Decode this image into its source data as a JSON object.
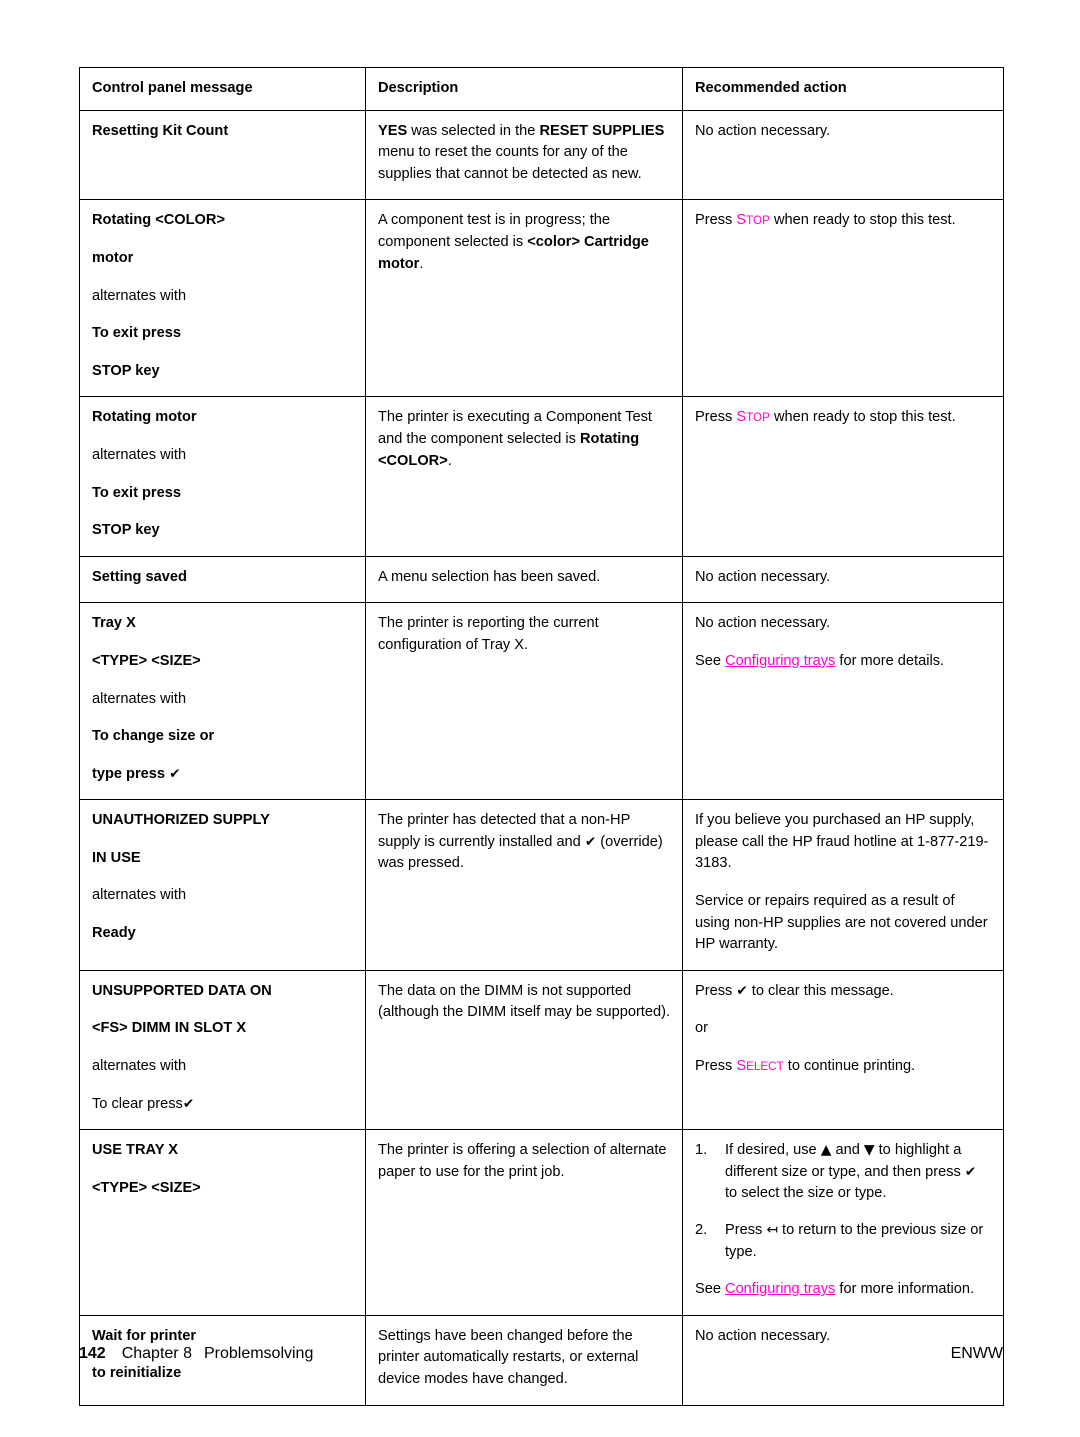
{
  "document": {
    "page_number": "142",
    "chapter": "Chapter 8",
    "section": "Problemsolving",
    "locale_code": "ENWW"
  },
  "colors": {
    "key_magenta": "#ff00cc",
    "link_magenta": "#ff00cc",
    "text": "#000000",
    "border": "#000000"
  },
  "table": {
    "headers": {
      "message": "Control panel message",
      "description": "Description",
      "action": "Recommended action"
    },
    "rows": [
      {
        "message_lines": [
          {
            "text": "Resetting Kit Count",
            "bold": true
          }
        ],
        "description": {
          "parts": [
            {
              "text": "YES",
              "bold": true
            },
            {
              "text": " was selected in the ",
              "bold": false
            },
            {
              "text": "RESET SUPPLIES",
              "bold": true
            },
            {
              "text": " menu to reset the counts for any of the supplies that cannot be detected as new.",
              "bold": false
            }
          ]
        },
        "action": {
          "paragraphs": [
            {
              "parts": [
                {
                  "text": "No action necessary.",
                  "bold": false
                }
              ]
            }
          ]
        }
      },
      {
        "message_lines": [
          {
            "text": "Rotating <COLOR>",
            "bold": true
          },
          {
            "text": "motor",
            "bold": true
          },
          {
            "text": "alternates with",
            "bold": false
          },
          {
            "text": "To exit press",
            "bold": true
          },
          {
            "text": "STOP key",
            "bold": true
          }
        ],
        "description": {
          "parts": [
            {
              "text": "A component test is in progress; the component selected is ",
              "bold": false
            },
            {
              "text": "<color> Cartridge motor",
              "bold": true
            },
            {
              "text": ".",
              "bold": false
            }
          ]
        },
        "action": {
          "paragraphs": [
            {
              "parts": [
                {
                  "text": "Press ",
                  "bold": false
                },
                {
                  "key": "Stop"
                },
                {
                  "text": " when ready to stop this test.",
                  "bold": false
                }
              ]
            }
          ]
        }
      },
      {
        "message_lines": [
          {
            "text": "Rotating motor",
            "bold": true
          },
          {
            "text": "alternates with",
            "bold": false
          },
          {
            "text": "To exit press",
            "bold": true
          },
          {
            "text": "STOP key",
            "bold": true
          }
        ],
        "description": {
          "parts": [
            {
              "text": "The printer is executing a Component Test and the component selected is ",
              "bold": false
            },
            {
              "text": "Rotating <COLOR>",
              "bold": true
            },
            {
              "text": ".",
              "bold": false
            }
          ]
        },
        "action": {
          "paragraphs": [
            {
              "parts": [
                {
                  "text": "Press ",
                  "bold": false
                },
                {
                  "key": "Stop"
                },
                {
                  "text": " when ready to stop this test.",
                  "bold": false
                }
              ]
            }
          ]
        }
      },
      {
        "message_lines": [
          {
            "text": "Setting saved",
            "bold": true
          }
        ],
        "description": {
          "parts": [
            {
              "text": "A menu selection has been saved.",
              "bold": false
            }
          ]
        },
        "action": {
          "paragraphs": [
            {
              "parts": [
                {
                  "text": "No action necessary.",
                  "bold": false
                }
              ]
            }
          ]
        }
      },
      {
        "message_lines": [
          {
            "text": "Tray X",
            "bold": true
          },
          {
            "text": "<TYPE> <SIZE>",
            "bold": true
          },
          {
            "text": "alternates with",
            "bold": false
          },
          {
            "text": "To change size or",
            "bold": true
          },
          {
            "text": "type press ✔",
            "bold": true
          }
        ],
        "description": {
          "parts": [
            {
              "text": "The printer is reporting the current configuration of Tray X.",
              "bold": false
            }
          ]
        },
        "action": {
          "paragraphs": [
            {
              "parts": [
                {
                  "text": "No action necessary.",
                  "bold": false
                }
              ]
            },
            {
              "parts": [
                {
                  "text": "See ",
                  "bold": false
                },
                {
                  "link": "Configuring trays"
                },
                {
                  "text": " for more details.",
                  "bold": false
                }
              ]
            }
          ]
        }
      },
      {
        "message_lines": [
          {
            "text": "UNAUTHORIZED SUPPLY",
            "bold": true
          },
          {
            "text": "IN USE",
            "bold": true
          },
          {
            "text": "alternates with",
            "bold": false
          },
          {
            "text": "Ready",
            "bold": true
          }
        ],
        "description": {
          "parts": [
            {
              "text": "The printer has detected that a non-HP supply is currently installed and ✔ (override) was pressed.",
              "bold": false
            }
          ]
        },
        "action": {
          "paragraphs": [
            {
              "parts": [
                {
                  "text": "If you believe you purchased an HP supply, please call the HP fraud hotline at 1-877-219-3183.",
                  "bold": false
                }
              ]
            },
            {
              "parts": [
                {
                  "text": "Service or repairs required as a result of using non-HP supplies are not covered under HP warranty.",
                  "bold": false
                }
              ]
            }
          ]
        }
      },
      {
        "message_lines": [
          {
            "text": "UNSUPPORTED DATA ON",
            "bold": true
          },
          {
            "text": "<FS> DIMM IN SLOT X",
            "bold": true
          },
          {
            "text": "alternates with",
            "bold": false
          },
          {
            "text": "To clear press✔",
            "bold": false
          }
        ],
        "description": {
          "parts": [
            {
              "text": "The data on the DIMM is not supported (although the DIMM itself may be supported).",
              "bold": false
            }
          ]
        },
        "action": {
          "paragraphs": [
            {
              "parts": [
                {
                  "text": "Press ✔ to clear this message.",
                  "bold": false
                }
              ]
            },
            {
              "parts": [
                {
                  "text": "or",
                  "bold": false
                }
              ]
            },
            {
              "parts": [
                {
                  "text": "Press ",
                  "bold": false
                },
                {
                  "key": "Select"
                },
                {
                  "text": " to continue printing.",
                  "bold": false
                }
              ]
            }
          ]
        }
      },
      {
        "message_lines": [
          {
            "text": "USE TRAY X",
            "bold": true
          },
          {
            "text": "<TYPE> <SIZE>",
            "bold": true
          }
        ],
        "description": {
          "parts": [
            {
              "text": "The printer is offering a selection of alternate paper to use for the print job.",
              "bold": false
            }
          ]
        },
        "action": {
          "steps": [
            "If desired, use ▲ and ▼ to highlight a different size or type, and then press ✔ to select the size or type.",
            "Press ↤ to return to the previous size or type."
          ],
          "paragraphs_after": [
            {
              "parts": [
                {
                  "text": "See ",
                  "bold": false
                },
                {
                  "link": "Configuring trays"
                },
                {
                  "text": " for more information.",
                  "bold": false
                }
              ]
            }
          ]
        }
      },
      {
        "message_lines": [
          {
            "text": "Wait for printer",
            "bold": true
          },
          {
            "text": "to reinitialize",
            "bold": true
          }
        ],
        "description": {
          "parts": [
            {
              "text": "Settings have been changed before the printer automatically restarts, or external device modes have changed.",
              "bold": false
            }
          ]
        },
        "action": {
          "paragraphs": [
            {
              "parts": [
                {
                  "text": "No action necessary.",
                  "bold": false
                }
              ]
            }
          ]
        }
      }
    ]
  }
}
